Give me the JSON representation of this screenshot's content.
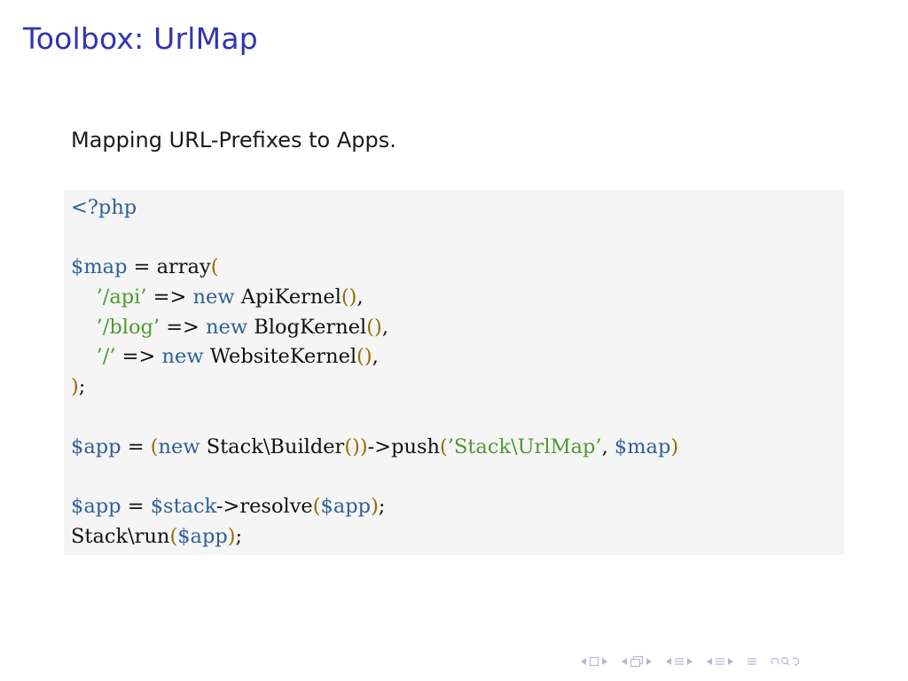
{
  "slide": {
    "title": "Toolbox: UrlMap",
    "subtitle": "Mapping URL-Prefixes to Apps."
  },
  "colors": {
    "title": "#3333b2",
    "code_background": "#f5f5f5",
    "code_default": "#111111",
    "variable": "#2f5f99",
    "keyword": "#2f5f99",
    "string": "#4e9a2f",
    "paren": "#9a6a00",
    "nav": "#b5b5d8"
  },
  "code_lines": [
    [
      {
        "t": "<?php",
        "c": "variable"
      }
    ],
    [],
    [
      {
        "t": "$map",
        "c": "variable"
      },
      {
        "t": " = array",
        "c": "code_default"
      },
      {
        "t": "(",
        "c": "paren"
      }
    ],
    [
      {
        "t": "    ",
        "c": "code_default"
      },
      {
        "t": "’/api’",
        "c": "string"
      },
      {
        "t": " => ",
        "c": "code_default"
      },
      {
        "t": "new",
        "c": "keyword"
      },
      {
        "t": " ApiKernel",
        "c": "code_default"
      },
      {
        "t": "()",
        "c": "paren"
      },
      {
        "t": ",",
        "c": "code_default"
      }
    ],
    [
      {
        "t": "    ",
        "c": "code_default"
      },
      {
        "t": "’/blog’",
        "c": "string"
      },
      {
        "t": " => ",
        "c": "code_default"
      },
      {
        "t": "new",
        "c": "keyword"
      },
      {
        "t": " BlogKernel",
        "c": "code_default"
      },
      {
        "t": "()",
        "c": "paren"
      },
      {
        "t": ",",
        "c": "code_default"
      }
    ],
    [
      {
        "t": "    ",
        "c": "code_default"
      },
      {
        "t": "’/’",
        "c": "string"
      },
      {
        "t": " => ",
        "c": "code_default"
      },
      {
        "t": "new",
        "c": "keyword"
      },
      {
        "t": " WebsiteKernel",
        "c": "code_default"
      },
      {
        "t": "()",
        "c": "paren"
      },
      {
        "t": ",",
        "c": "code_default"
      }
    ],
    [
      {
        "t": ")",
        "c": "paren"
      },
      {
        "t": ";",
        "c": "code_default"
      }
    ],
    [],
    [
      {
        "t": "$app",
        "c": "variable"
      },
      {
        "t": " = ",
        "c": "code_default"
      },
      {
        "t": "(",
        "c": "paren"
      },
      {
        "t": "new",
        "c": "keyword"
      },
      {
        "t": " Stack\\Builder",
        "c": "code_default"
      },
      {
        "t": "())",
        "c": "paren"
      },
      {
        "t": "->push",
        "c": "code_default"
      },
      {
        "t": "(",
        "c": "paren"
      },
      {
        "t": "’Stack\\UrlMap’",
        "c": "string"
      },
      {
        "t": ", ",
        "c": "code_default"
      },
      {
        "t": "$map",
        "c": "variable"
      },
      {
        "t": ")",
        "c": "paren"
      }
    ],
    [],
    [
      {
        "t": "$app",
        "c": "variable"
      },
      {
        "t": " = ",
        "c": "code_default"
      },
      {
        "t": "$stack",
        "c": "variable"
      },
      {
        "t": "->resolve",
        "c": "code_default"
      },
      {
        "t": "(",
        "c": "paren"
      },
      {
        "t": "$app",
        "c": "variable"
      },
      {
        "t": ")",
        "c": "paren"
      },
      {
        "t": ";",
        "c": "code_default"
      }
    ],
    [
      {
        "t": "Stack\\run",
        "c": "code_default"
      },
      {
        "t": "(",
        "c": "paren"
      },
      {
        "t": "$app",
        "c": "variable"
      },
      {
        "t": ")",
        "c": "paren"
      },
      {
        "t": ";",
        "c": "code_default"
      }
    ]
  ],
  "nav_icons": [
    "frame-prev-icon",
    "frame-box-icon",
    "frame-next-icon",
    "subsection-prev-icon",
    "subsection-icon",
    "subsection-next-icon",
    "section-prev-icon",
    "section-icon",
    "section-next-icon",
    "align-icon",
    "search-loop-icon"
  ]
}
